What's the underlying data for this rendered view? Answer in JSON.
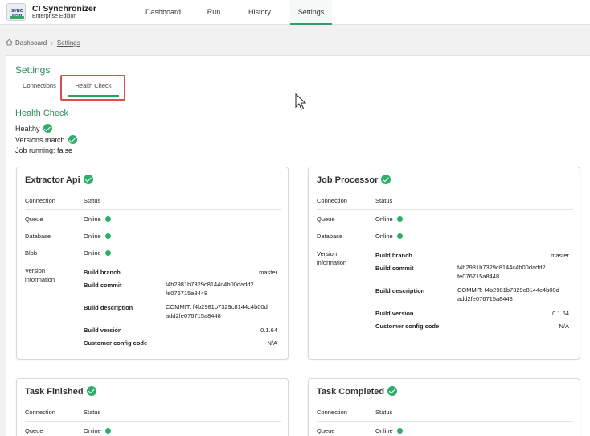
{
  "app": {
    "logo_text": "SYNC FISH",
    "name": "CI Synchronizer",
    "edition": "Enterprise Edition"
  },
  "nav": {
    "dashboard": "Dashboard",
    "run": "Run",
    "history": "History",
    "settings": "Settings"
  },
  "breadcrumb": {
    "home": "Dashboard",
    "sep": "‹",
    "current": "Settings"
  },
  "page": {
    "title": "Settings"
  },
  "tabs": {
    "connections": "Connections",
    "health_check": "Health Check"
  },
  "health": {
    "title": "Health Check",
    "healthy": "Healthy",
    "versions_match": "Versions match",
    "job_running": "Job running:  false"
  },
  "headers": {
    "connection": "Connection",
    "status": "Status"
  },
  "extractor": {
    "title": "Extractor Api",
    "rows": [
      {
        "name": "Queue",
        "status": "Online"
      },
      {
        "name": "Database",
        "status": "Online"
      },
      {
        "name": "Blob",
        "status": "Online"
      }
    ],
    "version_label": "Version information",
    "build_branch_label": "Build branch",
    "build_branch": "master",
    "build_commit_label": "Build commit",
    "build_commit": "f4b2981b7329c8144c4b00dadd2fe076715a8448",
    "build_description_label": "Build description",
    "build_description": "COMMIT: f4b2981b7329c8144c4b00dadd2fe076715a8448",
    "build_version_label": "Build version",
    "build_version": "0.1.64",
    "customer_config_label": "Customer config code",
    "customer_config": "N/A"
  },
  "processor": {
    "title": "Job Processor",
    "rows": [
      {
        "name": "Queue",
        "status": "Online"
      },
      {
        "name": "Database",
        "status": "Online"
      }
    ],
    "version_label": "Version information",
    "build_branch_label": "Build branch",
    "build_branch": "master",
    "build_commit_label": "Build commit",
    "build_commit": "f4b2981b7329c8144c4b00dadd2fe076715a8448",
    "build_description_label": "Build description",
    "build_description": "COMMIT: f4b2981b7329c8144c4b00dadd2fe076715a8448",
    "build_version_label": "Build version",
    "build_version": "0.1.64",
    "customer_config_label": "Customer config code",
    "customer_config": "N/A"
  },
  "task_finished": {
    "title": "Task Finished",
    "rows": [
      {
        "name": "Queue",
        "status": "Online"
      }
    ]
  },
  "task_completed": {
    "title": "Task Completed",
    "rows": [
      {
        "name": "Queue",
        "status": "Online"
      }
    ]
  },
  "colors": {
    "accent": "#2e9e6a",
    "title_green": "#2e8a5c",
    "status_online": "#2eae6a",
    "highlight": "#e04a4a"
  },
  "icons": {
    "home": "home-icon",
    "check": "check-circle-icon",
    "status": "status-dot-icon",
    "cursor": "mouse-pointer-icon"
  }
}
